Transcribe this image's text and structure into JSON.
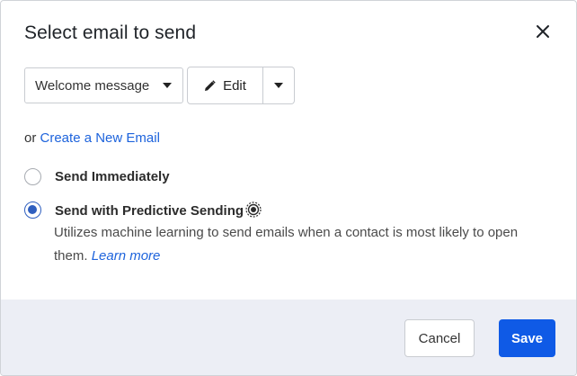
{
  "dialog": {
    "title": "Select email to send"
  },
  "email_select": {
    "selected": "Welcome message"
  },
  "edit_button": {
    "label": "Edit"
  },
  "create_link": {
    "prefix": "or",
    "link_text": "Create a New Email"
  },
  "options": [
    {
      "label": "Send Immediately",
      "checked": false
    },
    {
      "label": "Send with Predictive Sending",
      "checked": true
    }
  ],
  "predictive_description": {
    "text": "Utilizes machine learning to send emails when a contact is most likely to open them.",
    "link_text": "Learn more"
  },
  "footer": {
    "cancel_label": "Cancel",
    "save_label": "Save"
  },
  "colors": {
    "accent": "#0f5ae6",
    "link": "#1d63dc",
    "footer_bg": "#eceef5",
    "radio_checked": "#2f5fbf"
  },
  "icons": [
    "close-icon",
    "caret-down-icon",
    "pencil-icon",
    "predictive-sending-icon"
  ]
}
